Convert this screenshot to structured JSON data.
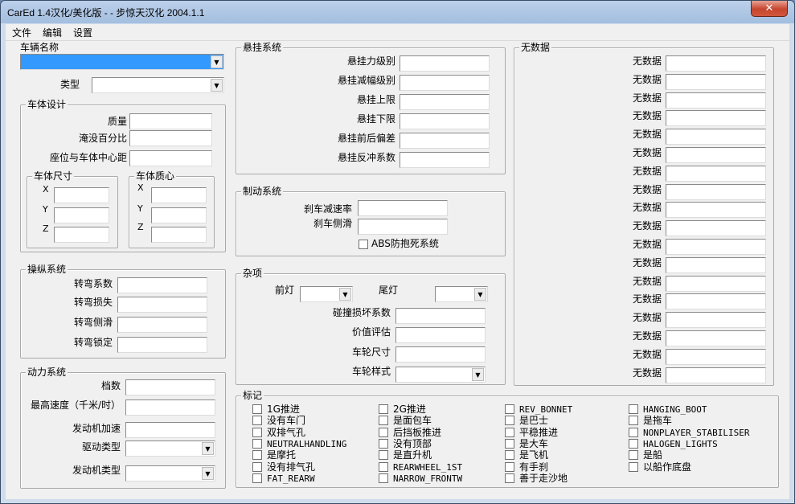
{
  "window": {
    "title": "CarEd 1.4汉化/美化版 - - 步惊天汉化 2004.1.1",
    "close_glyph": "✕"
  },
  "menu": [
    "文件",
    "编辑",
    "设置"
  ],
  "vehicle": {
    "name_label": "车辆名称",
    "type_label": "类型"
  },
  "body_design": {
    "title": "车体设计",
    "mass_label": "质量",
    "submerge_label": "淹没百分比",
    "seat_label": "座位与车体中心距",
    "size_title": "车体尺寸",
    "center_title": "车体质心",
    "axes": [
      "X",
      "Y",
      "Z"
    ]
  },
  "steering": {
    "title": "操纵系统",
    "labels": [
      "转弯系数",
      "转弯损失",
      "转弯侧滑",
      "转弯锁定"
    ]
  },
  "power": {
    "title": "动力系统",
    "gears_label": "档数",
    "max_speed_label": "最高速度（千米/时）",
    "accel_label": "发动机加速",
    "drive_type_label": "驱动类型",
    "engine_type_label": "发动机类型"
  },
  "suspension": {
    "title": "悬挂系统",
    "labels": [
      "悬挂力级别",
      "悬挂减幅级别",
      "悬挂上限",
      "悬挂下限",
      "悬挂前后偏差",
      "悬挂反冲系数"
    ]
  },
  "brakes": {
    "title": "制动系统",
    "decel_label": "刹车减速率",
    "skid_label": "刹车侧滑",
    "abs_label": "ABS防抱死系统"
  },
  "misc": {
    "title": "杂项",
    "headlight_label": "前灯",
    "taillight_label": "尾灯",
    "collision_label": "碰撞损坏系数",
    "value_label": "价值评估",
    "wheel_size_label": "车轮尺寸",
    "wheel_style_label": "车轮样式"
  },
  "nodata": {
    "title": "无数据",
    "row_label": "无数据",
    "rows": [
      "无数据",
      "无数据",
      "无数据",
      "无数据",
      "无数据",
      "无数据",
      "无数据",
      "无数据",
      "无数据",
      "无数据",
      "无数据",
      "无数据",
      "无数据",
      "无数据",
      "无数据",
      "无数据",
      "无数据",
      "无数据"
    ]
  },
  "flags": {
    "title": "标记",
    "columns": [
      [
        "1G推进",
        "没有车门",
        "双排气孔",
        "NEUTRALHANDLING",
        "是摩托",
        "没有排气孔",
        "FAT_REARW"
      ],
      [
        "2G推进",
        "是面包车",
        "后挡板推进",
        "没有顶部",
        "是直升机",
        "REARWHEEL_1ST",
        "NARROW_FRONTW"
      ],
      [
        "REV_BONNET",
        "是巴士",
        "平稳推进",
        "是大车",
        "是飞机",
        "有手刹",
        "善于走沙地"
      ],
      [
        "HANGING_BOOT",
        "是拖车",
        "NONPLAYER_STABILISER",
        "HALOGEN_LIGHTS",
        "是船",
        "以船作底盘"
      ]
    ]
  },
  "ui": {
    "combo_arrow": "▼"
  }
}
